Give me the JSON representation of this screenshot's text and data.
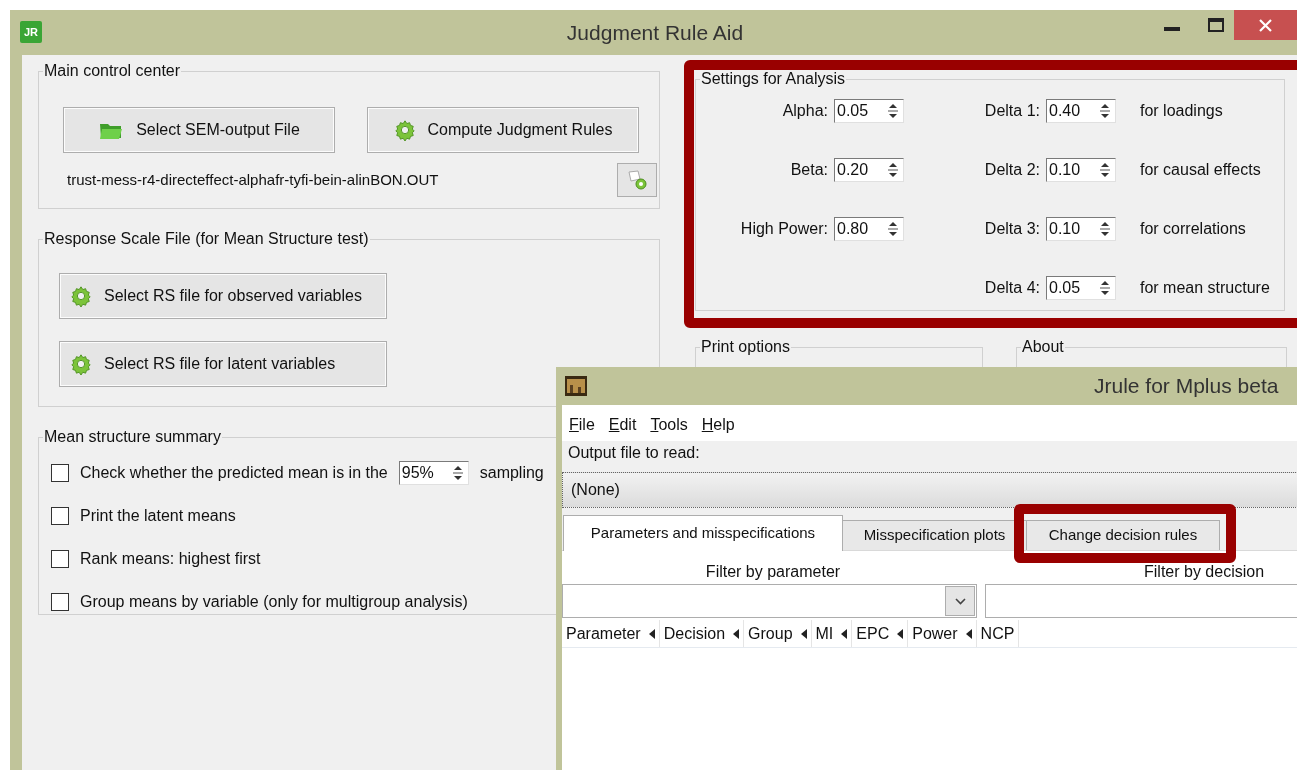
{
  "main_window": {
    "title": "Judgment Rule Aid",
    "app_icon": "JR",
    "main_control_center": {
      "title": "Main control center",
      "buttons": [
        {
          "label": "Select SEM-output File",
          "kind": "folder"
        },
        {
          "label": "Compute Judgment Rules",
          "kind": "gear"
        }
      ],
      "file_name": "trust-mess-r4-directeffect-alphafr-tyfi-bein-alinBON.OUT"
    },
    "response_scale": {
      "title": "Response Scale File (for Mean Structure test)",
      "buttons": [
        "Select RS file for observed variables",
        "Select RS file for latent variables"
      ]
    },
    "mean_structure": {
      "title": "Mean structure summary",
      "options": [
        {
          "label": "Check whether the predicted mean is in the",
          "checked": false,
          "spin_value": "95%",
          "suffix": "sampling"
        },
        {
          "label": "Print the latent means",
          "checked": false
        },
        {
          "label": "Rank means: highest first",
          "checked": false
        },
        {
          "label": "Group means by variable (only for multigroup analysis)",
          "checked": false
        }
      ]
    },
    "settings": {
      "title": "Settings for Analysis",
      "params": [
        {
          "label": "Alpha:",
          "value": "0.05"
        },
        {
          "label": "Beta:",
          "value": "0.20"
        },
        {
          "label": "High Power:",
          "value": "0.80"
        }
      ],
      "deltas": [
        {
          "label": "Delta 1:",
          "value": "0.40",
          "note": "for loadings"
        },
        {
          "label": "Delta 2:",
          "value": "0.10",
          "note": "for causal effects"
        },
        {
          "label": "Delta 3:",
          "value": "0.10",
          "note": "for correlations"
        },
        {
          "label": "Delta 4:",
          "value": "0.05",
          "note": "for mean structure"
        }
      ]
    },
    "print_options": {
      "title": "Print options"
    },
    "about": {
      "title": "About"
    }
  },
  "jrule_window": {
    "title": "Jrule for Mplus beta",
    "menu": [
      "File",
      "Edit",
      "Tools",
      "Help"
    ],
    "output_label": "Output file to read:",
    "output_value": "(None)",
    "tabs": [
      {
        "label": "Parameters and misspecifications",
        "selected": true
      },
      {
        "label": "Misspecification plots",
        "selected": false
      },
      {
        "label": "Change decision rules",
        "selected": false
      }
    ],
    "filters": [
      "Filter by parameter",
      "Filter by decision"
    ],
    "columns": [
      "Parameter",
      "Decision",
      "Group",
      "MI",
      "EPC",
      "Power",
      "NCP"
    ]
  }
}
